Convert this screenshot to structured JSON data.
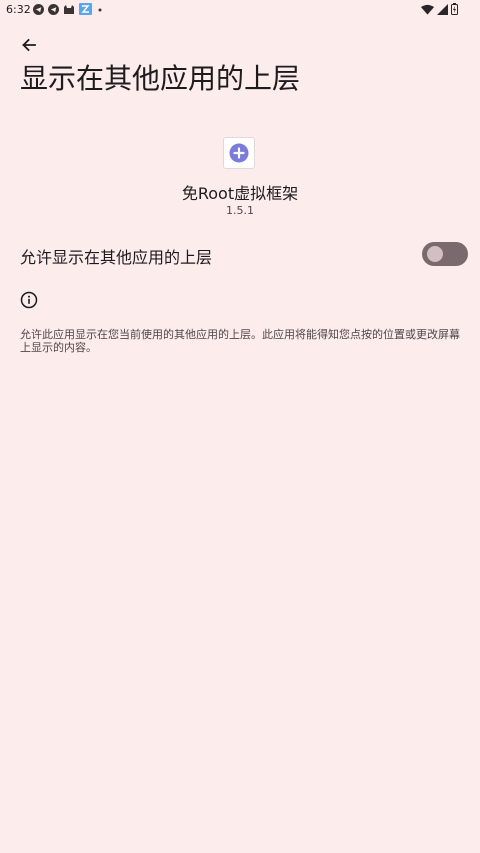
{
  "status_bar": {
    "time": "6:32",
    "left_icons": [
      "telegram-icon",
      "telegram-icon",
      "cat-icon",
      "app-icon",
      "dot-icon"
    ],
    "right_icons": [
      "wifi-icon",
      "signal-icon",
      "battery-icon"
    ]
  },
  "header": {
    "title": "显示在其他应用的上层"
  },
  "app": {
    "name": "免Root虚拟框架",
    "version": "1.5.1",
    "icon": "plus-circle-icon"
  },
  "setting": {
    "label": "允许显示在其他应用的上层",
    "enabled": false
  },
  "info": {
    "text": "允许此应用显示在您当前使用的其他应用的上层。此应用将能得知您点按的位置或更改屏幕上显示的内容。"
  },
  "colors": {
    "background": "#fcecec",
    "toggle_track": "#7a6a6d",
    "toggle_thumb": "#d3bfc2",
    "app_icon_accent": "#7b7bdc"
  }
}
